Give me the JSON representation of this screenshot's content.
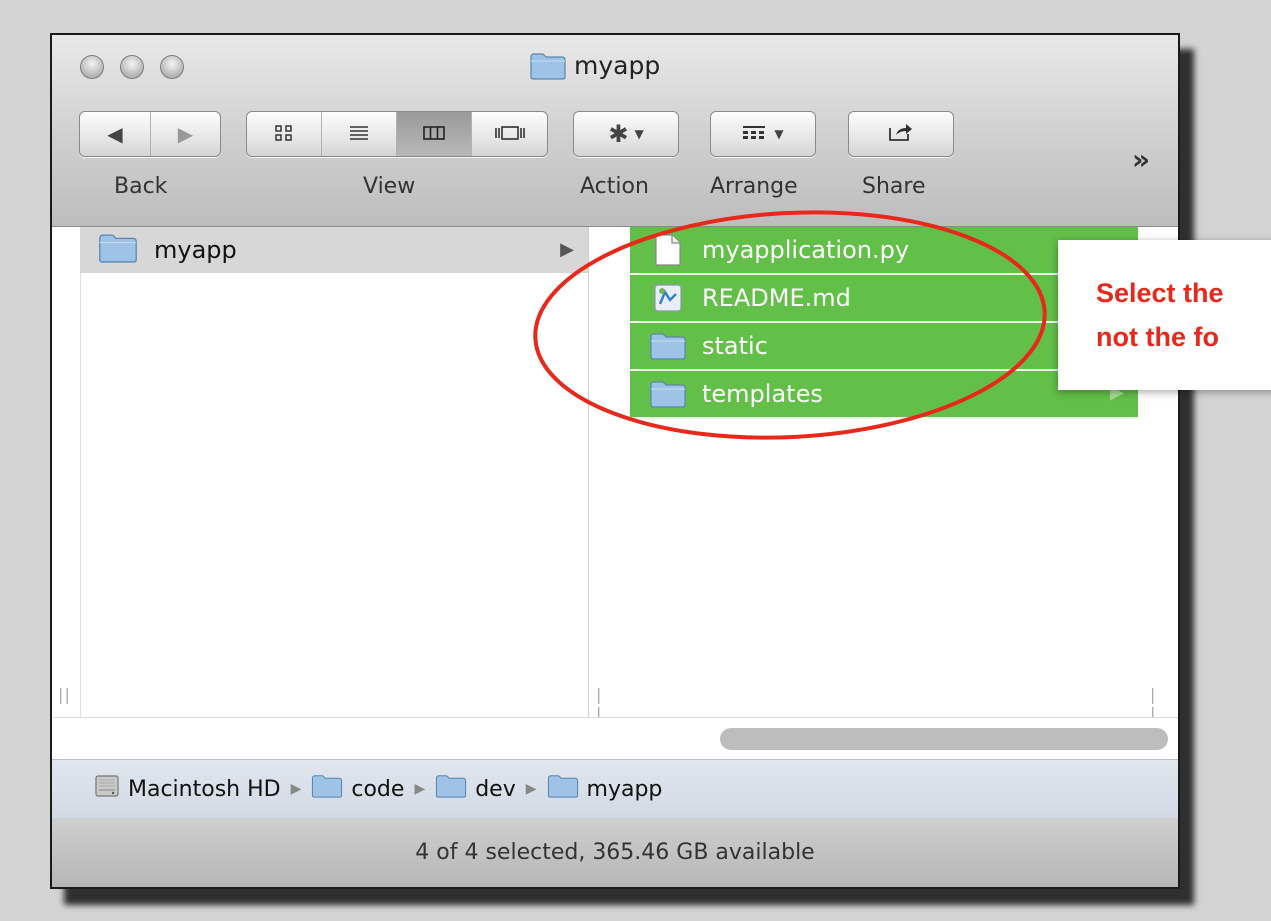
{
  "window": {
    "title": "myapp"
  },
  "toolbar": {
    "back_label": "Back",
    "view_label": "View",
    "action_label": "Action",
    "arrange_label": "Arrange",
    "share_label": "Share",
    "overflow": "»",
    "active_view": "column"
  },
  "left_column": {
    "items": [
      {
        "name": "myapp",
        "icon": "folder-icon",
        "selected": true
      }
    ]
  },
  "right_column": {
    "items": [
      {
        "name": "myapplication.py",
        "icon": "document-icon",
        "selected": true
      },
      {
        "name": "README.md",
        "icon": "markdown-file-icon",
        "selected": true
      },
      {
        "name": "static",
        "icon": "folder-icon",
        "selected": true
      },
      {
        "name": "templates",
        "icon": "folder-icon",
        "selected": true
      }
    ]
  },
  "path_bar": {
    "crumbs": [
      {
        "name": "Macintosh HD",
        "icon": "hard-drive-icon"
      },
      {
        "name": "code",
        "icon": "folder-icon"
      },
      {
        "name": "dev",
        "icon": "folder-icon"
      },
      {
        "name": "myapp",
        "icon": "folder-icon"
      }
    ]
  },
  "status": {
    "text": "4 of 4 selected, 365.46 GB available"
  },
  "callout": {
    "line1": "Select the",
    "line2": "not the fo"
  },
  "colors": {
    "selection": "#62bf47",
    "annotation": "#e8281a"
  }
}
